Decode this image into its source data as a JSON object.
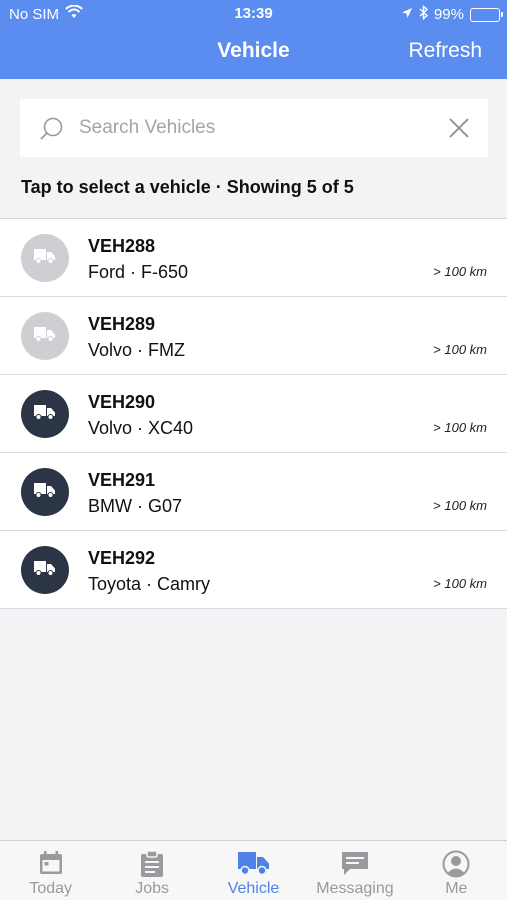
{
  "status_bar": {
    "carrier": "No SIM",
    "time": "13:39",
    "battery": "99%"
  },
  "nav": {
    "title": "Vehicle",
    "action": "Refresh"
  },
  "search": {
    "placeholder": "Search Vehicles",
    "value": ""
  },
  "hint": "Tap to select a vehicle · Showing 5 of 5",
  "vehicles": [
    {
      "id": "VEH288",
      "desc": "Ford · F-650",
      "distance": "> 100 km",
      "state": "inactive"
    },
    {
      "id": "VEH289",
      "desc": "Volvo · FMZ",
      "distance": "> 100 km",
      "state": "inactive"
    },
    {
      "id": "VEH290",
      "desc": "Volvo · XC40",
      "distance": "> 100 km",
      "state": "active"
    },
    {
      "id": "VEH291",
      "desc": "BMW · G07",
      "distance": "> 100 km",
      "state": "active"
    },
    {
      "id": "VEH292",
      "desc": "Toyota · Camry",
      "distance": "> 100 km",
      "state": "active"
    }
  ],
  "tabs": [
    {
      "label": "Today",
      "icon": "calendar-icon"
    },
    {
      "label": "Jobs",
      "icon": "clipboard-icon"
    },
    {
      "label": "Vehicle",
      "icon": "truck-icon",
      "active": true
    },
    {
      "label": "Messaging",
      "icon": "chat-icon"
    },
    {
      "label": "Me",
      "icon": "user-icon"
    }
  ],
  "colors": {
    "header": "#5b8df0",
    "active_tab": "#4f82e8",
    "avatar_active": "#2c3545",
    "avatar_inactive": "#cfcfd3"
  }
}
